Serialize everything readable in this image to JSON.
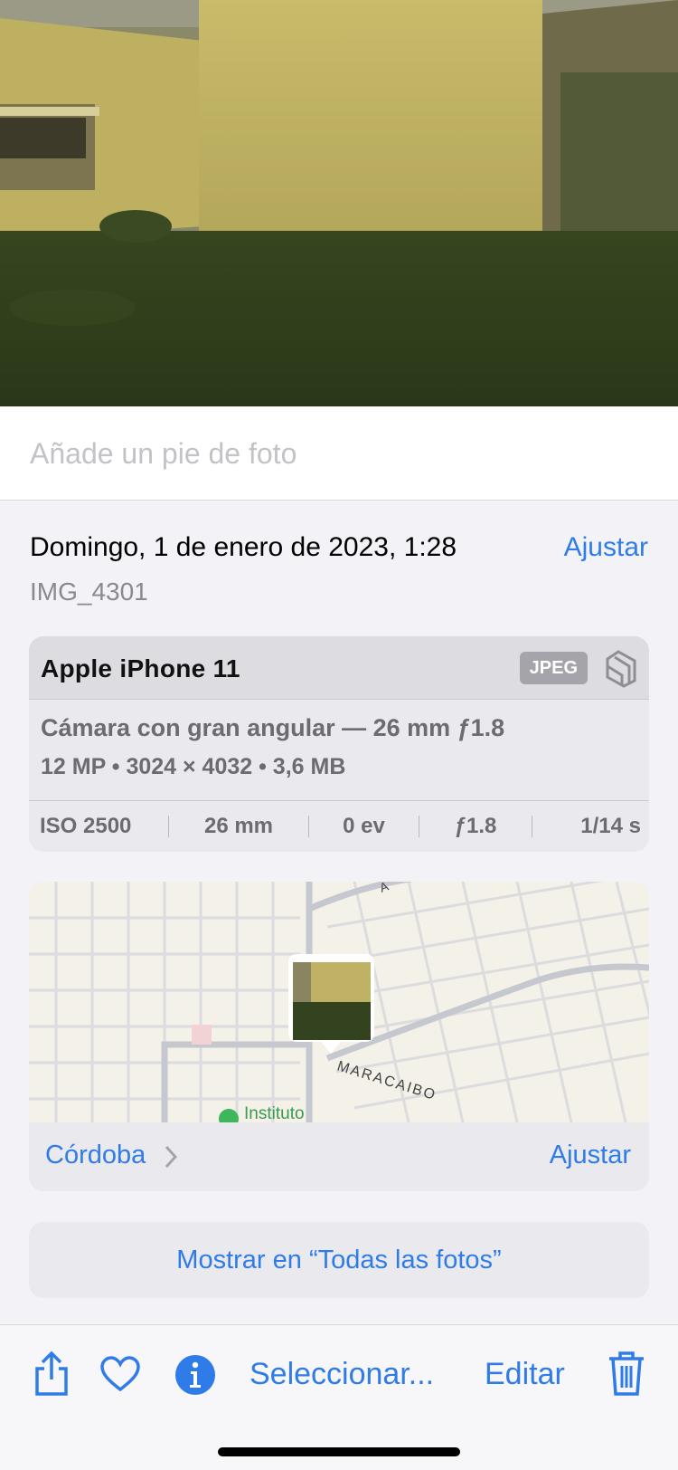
{
  "caption": {
    "placeholder": "Añade un pie de foto"
  },
  "info": {
    "date": "Domingo, 1 de enero de 2023, 1:28",
    "adjust_label": "Ajustar",
    "filename": "IMG_4301"
  },
  "camera": {
    "device": "Apple iPhone 11",
    "format_badge": "JPEG",
    "lens": "Cámara con gran angular — 26 mm ƒ1.8",
    "specs": "12 MP  •  3024 × 4032  •  3,6 MB",
    "exif": [
      "ISO 2500",
      "26 mm",
      "0 ev",
      "ƒ1.8",
      "1/14 s"
    ]
  },
  "map": {
    "street_label": "MARACAIBO",
    "poi_label": "Instituto",
    "top_street_fragment": "A",
    "place": "Córdoba",
    "adjust_label": "Ajustar"
  },
  "show_all_label": "Mostrar en “Todas las fotos”",
  "toolbar": {
    "select_label": "Seleccionar...",
    "edit_label": "Editar",
    "icons": [
      "share-icon",
      "heart-icon",
      "info-icon",
      "trash-icon"
    ]
  },
  "colors": {
    "accent": "#2f7ce9",
    "background": "#f2f2f7"
  }
}
